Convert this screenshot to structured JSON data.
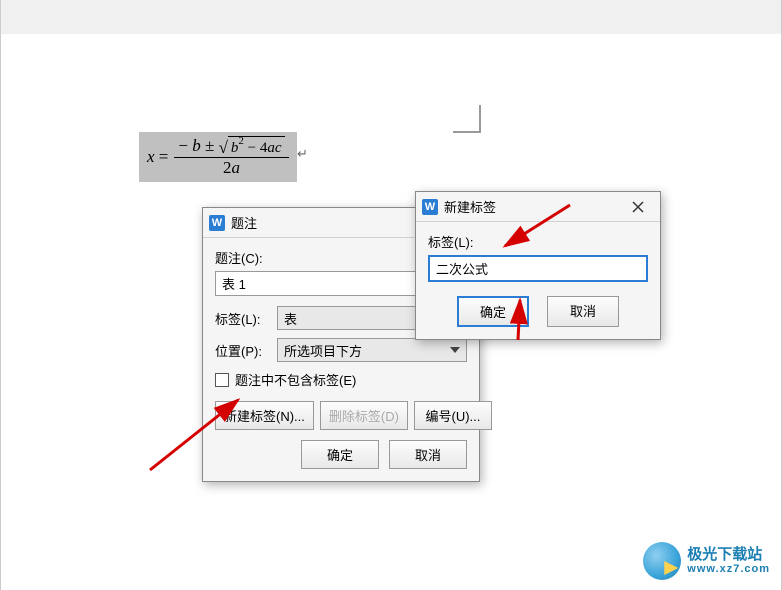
{
  "formula_text": "x = (−b ± √(b² − 4ac)) / 2a",
  "caption_dialog": {
    "title": "题注",
    "caption_label": "题注(C):",
    "caption_value": "表 1",
    "label_label": "标签(L):",
    "label_value": "表",
    "position_label": "位置(P):",
    "position_value": "所选项目下方",
    "exclude_label": "题注中不包含标签(E)",
    "new_label_btn": "新建标签(N)...",
    "delete_label_btn": "删除标签(D)",
    "numbering_btn": "编号(U)...",
    "ok_btn": "确定",
    "cancel_btn": "取消"
  },
  "newlabel_dialog": {
    "title": "新建标签",
    "label_label": "标签(L):",
    "input_value": "二次公式",
    "ok_btn": "确定",
    "cancel_btn": "取消"
  },
  "watermark": {
    "zh": "极光下载站",
    "en": "www.xz7.com"
  }
}
